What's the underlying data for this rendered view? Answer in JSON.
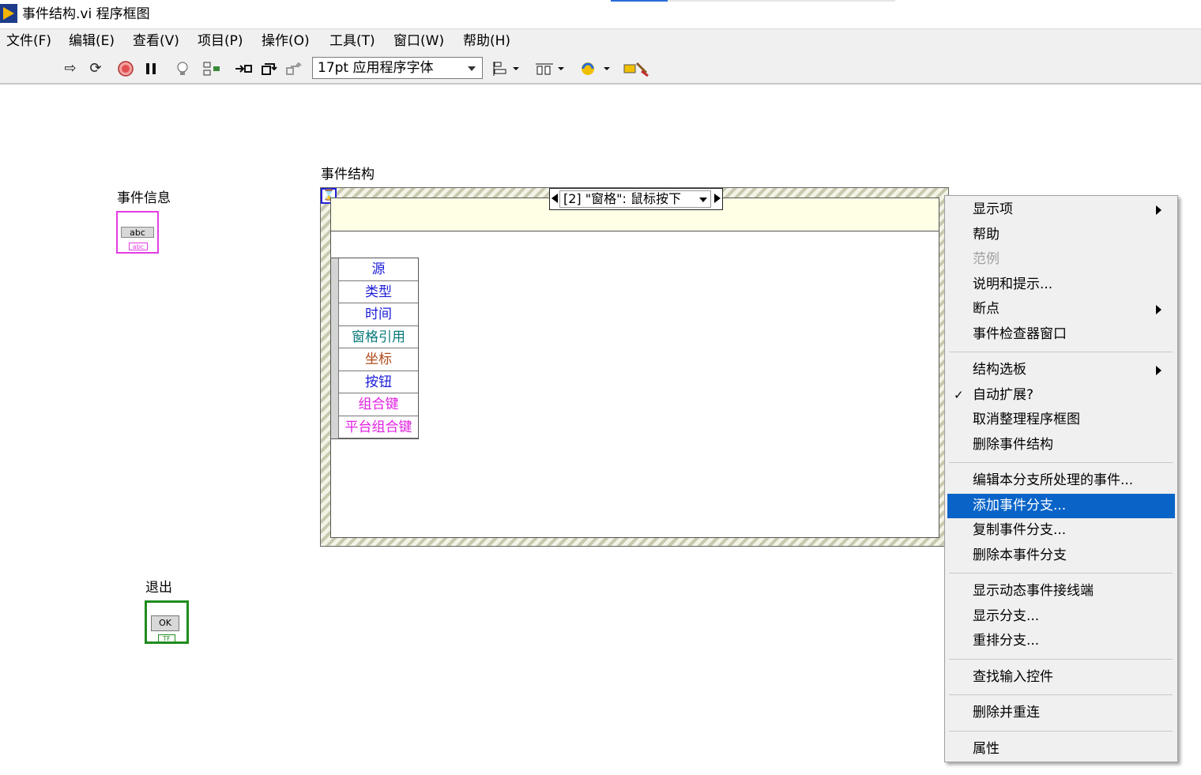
{
  "window": {
    "title": "事件结构.vi 程序框图"
  },
  "menubar": {
    "items": [
      "文件(F)",
      "编辑(E)",
      "查看(V)",
      "项目(P)",
      "操作(O)",
      "工具(T)",
      "窗口(W)",
      "帮助(H)"
    ]
  },
  "toolbar": {
    "icons": [
      "run-arrow-icon",
      "run-continuous-icon",
      "abort-icon",
      "pause-icon",
      "highlight-execution-icon",
      "retain-wire-values-icon",
      "step-into-icon",
      "step-over-icon",
      "step-out-icon",
      "align-icon",
      "distribute-icon",
      "reorder-icon",
      "cleanup-diagram-icon"
    ],
    "font_select": "17pt 应用程序字体"
  },
  "diagram": {
    "event_info_label": "事件信息",
    "event_info_inner": "abc",
    "event_info_tag": "abc",
    "exit_label": "退出",
    "exit_inner": "OK",
    "exit_tag": "TF",
    "event_structure_label": "事件结构",
    "event_case": "[2] \"窗格\": 鼠标按下",
    "event_data_fields": [
      {
        "label": "源",
        "color": "#1c1cd8"
      },
      {
        "label": "类型",
        "color": "#1c1cd8"
      },
      {
        "label": "时间",
        "color": "#1c1cd8"
      },
      {
        "label": "窗格引用",
        "color": "#0a7a7a"
      },
      {
        "label": "坐标",
        "color": "#b04a1a"
      },
      {
        "label": "按钮",
        "color": "#1c1cd8"
      },
      {
        "label": "组合键",
        "color": "#e020e0"
      },
      {
        "label": "平台组合键",
        "color": "#e020e0"
      }
    ]
  },
  "context_menu": {
    "items": [
      {
        "label": "显示项",
        "submenu": true
      },
      {
        "label": "帮助"
      },
      {
        "label": "范例",
        "disabled": true
      },
      {
        "label": "说明和提示..."
      },
      {
        "label": "断点",
        "submenu": true
      },
      {
        "label": "事件检查器窗口"
      },
      {
        "separator": true
      },
      {
        "label": "结构选板",
        "submenu": true
      },
      {
        "label": "自动扩展?",
        "checked": true
      },
      {
        "label": "取消整理程序框图"
      },
      {
        "label": "删除事件结构"
      },
      {
        "separator": true
      },
      {
        "label": "编辑本分支所处理的事件..."
      },
      {
        "label": "添加事件分支...",
        "highlighted": true
      },
      {
        "label": "复制事件分支..."
      },
      {
        "label": "删除本事件分支"
      },
      {
        "separator": true
      },
      {
        "label": "显示动态事件接线端"
      },
      {
        "label": "显示分支..."
      },
      {
        "label": "重排分支..."
      },
      {
        "separator": true
      },
      {
        "label": "查找输入控件"
      },
      {
        "separator": true
      },
      {
        "label": "删除并重连"
      },
      {
        "separator": true
      },
      {
        "label": "属性"
      }
    ],
    "check_mark": "✓"
  }
}
